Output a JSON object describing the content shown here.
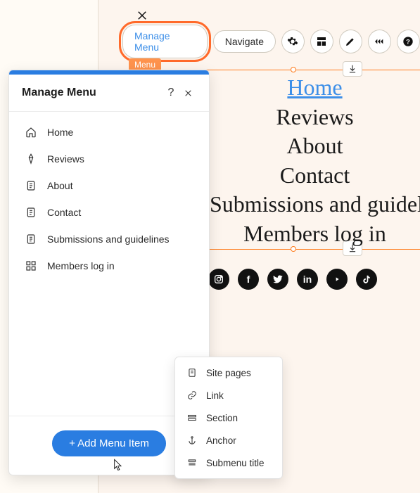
{
  "toolbar": {
    "manage_menu": "Manage Menu",
    "navigate": "Navigate"
  },
  "badge": "Menu",
  "page_nav": [
    "Home",
    "Reviews",
    "About",
    "Contact",
    "Submissions and guidelines",
    "Members log in"
  ],
  "panel": {
    "title": "Manage Menu",
    "items": [
      {
        "label": "Home"
      },
      {
        "label": "Reviews"
      },
      {
        "label": "About"
      },
      {
        "label": "Contact"
      },
      {
        "label": "Submissions and guidelines"
      },
      {
        "label": "Members log in"
      }
    ],
    "add_button": "+ Add Menu Item"
  },
  "dropdown": {
    "items": [
      "Site pages",
      "Link",
      "Section",
      "Anchor",
      "Submenu title"
    ]
  },
  "socials": [
    "instagram",
    "facebook",
    "twitter",
    "linkedin",
    "youtube",
    "tiktok"
  ],
  "colors": {
    "accent_orange": "#ff6a2b",
    "primary_blue": "#2a7de1",
    "link_blue": "#3d8fe8"
  }
}
